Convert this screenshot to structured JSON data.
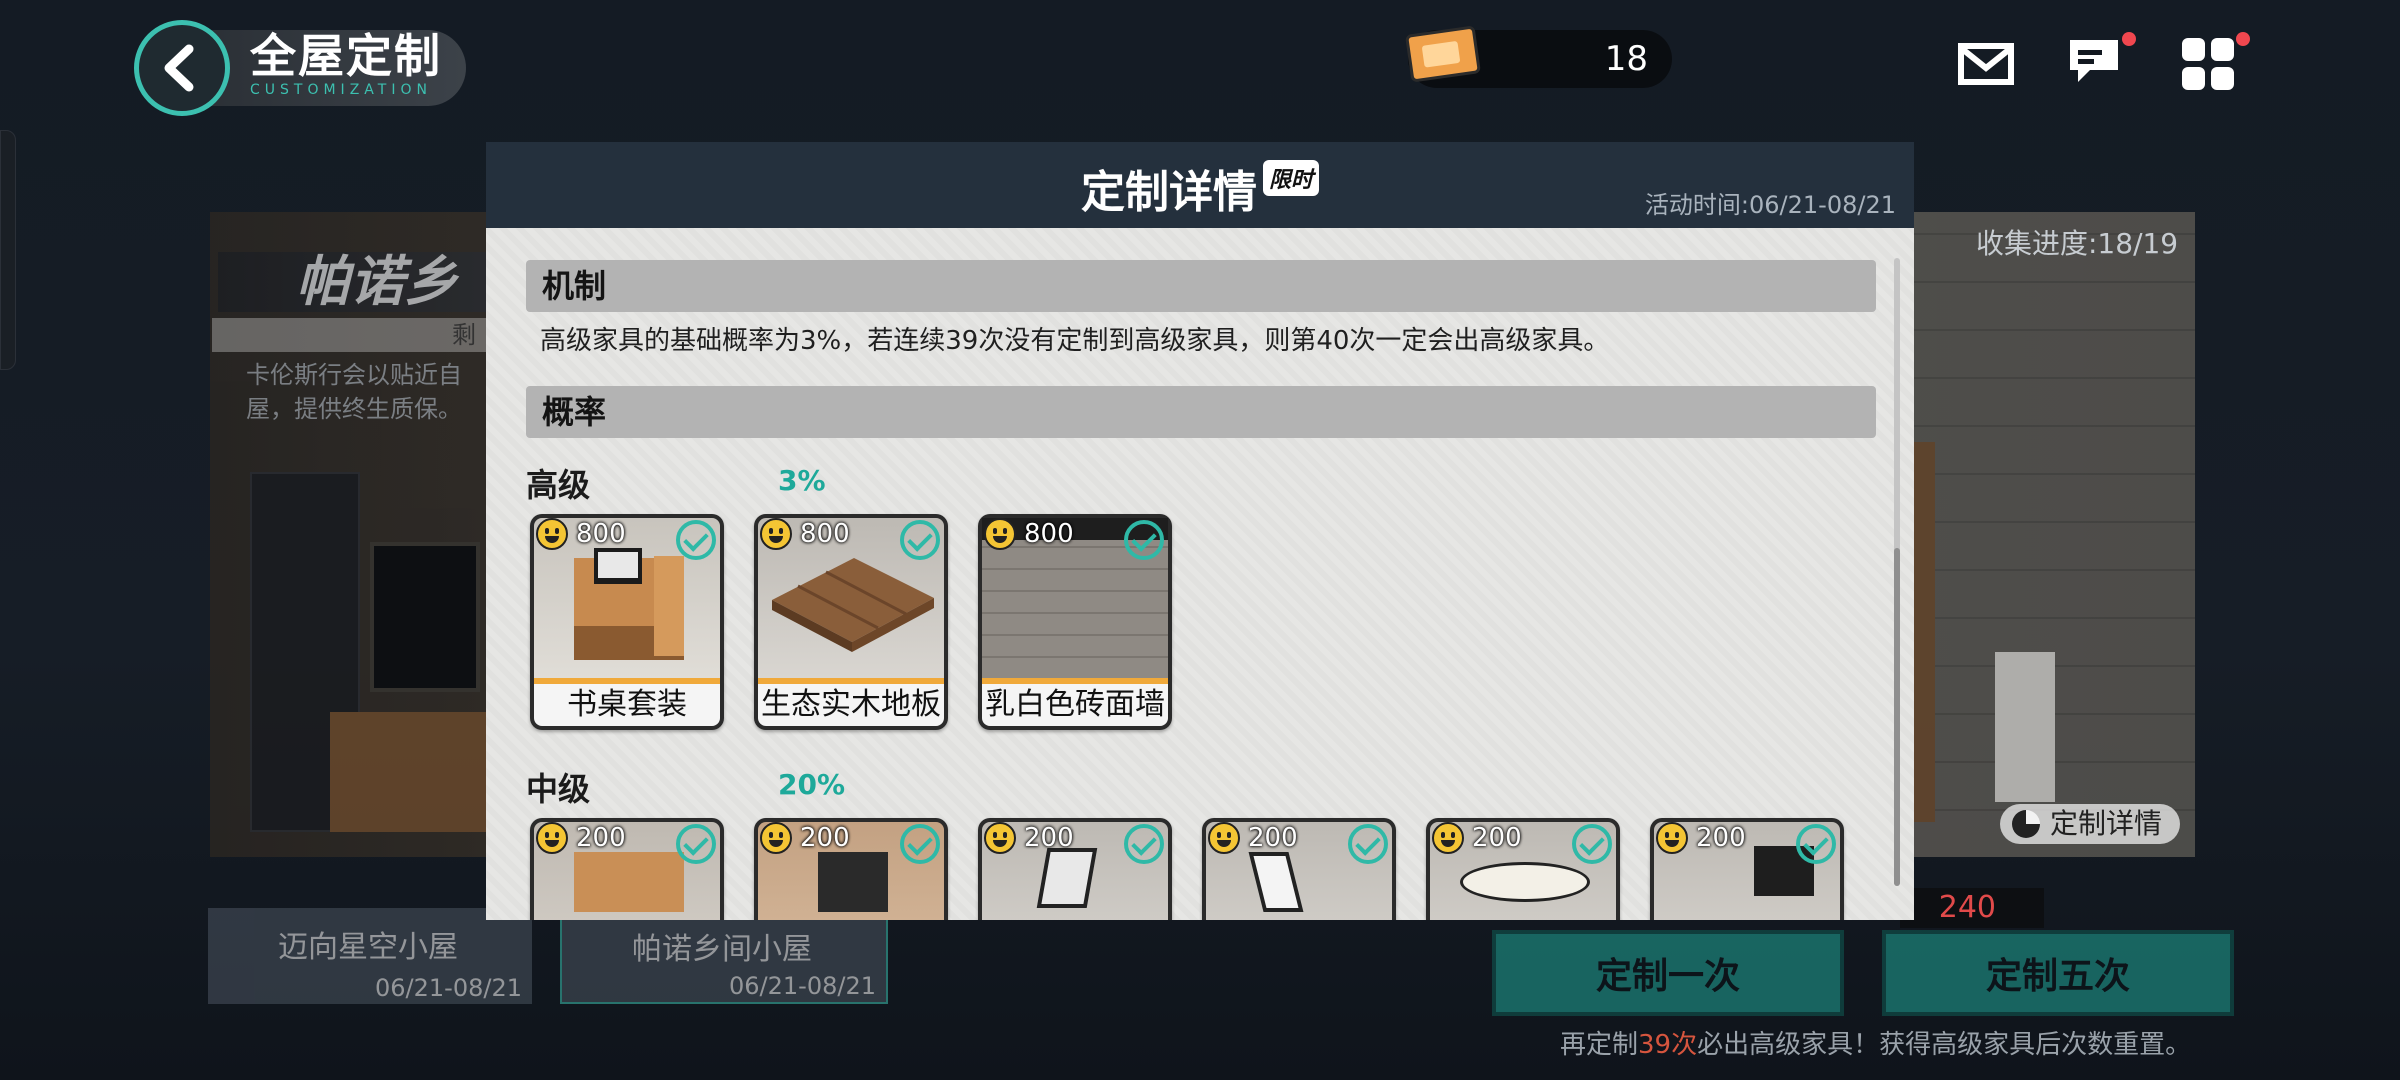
{
  "header": {
    "title": "全屋定制",
    "subtitle": "CUSTOMIZATION",
    "currency_value": "18"
  },
  "background": {
    "room_title": "帕诺乡",
    "room_remaining": "剩",
    "room_desc": "卡伦斯行会以贴近自\n屋，提供终生质保。",
    "collect_progress": "收集进度:18/19",
    "detail_button": "定制详情",
    "cost_value": "240",
    "buttons": {
      "once": "定制一次",
      "five": "定制五次"
    },
    "hint": {
      "pre": "再定制",
      "count": "39次",
      "post": "必出高级家具！获得高级家具后次数重置。"
    },
    "cards": [
      {
        "title": "迈向星空小屋",
        "date": "06/21-08/21"
      },
      {
        "title": "帕诺乡间小屋",
        "date": "06/21-08/21"
      }
    ]
  },
  "modal": {
    "title": "定制详情",
    "limited_tag": "限时",
    "activity_time": "活动时间:06/21-08/21",
    "mechanism_header": "机制",
    "mechanism_text": "高级家具的基础概率为3%，若连续39次没有定制到高级家具，则第40次一定会出高级家具。",
    "probability_header": "概率",
    "tiers": [
      {
        "label": "高级",
        "percent": "3%",
        "items": [
          {
            "cost": "800",
            "name": "书桌套装",
            "owned": true
          },
          {
            "cost": "800",
            "name": "生态实木地板",
            "owned": true
          },
          {
            "cost": "800",
            "name": "乳白色砖面墙",
            "owned": true
          }
        ]
      },
      {
        "label": "中级",
        "percent": "20%",
        "items": [
          {
            "cost": "200",
            "owned": true
          },
          {
            "cost": "200",
            "owned": true
          },
          {
            "cost": "200",
            "owned": true
          },
          {
            "cost": "200",
            "owned": true
          },
          {
            "cost": "200",
            "owned": true
          },
          {
            "cost": "200",
            "owned": true
          }
        ]
      }
    ]
  },
  "colors": {
    "accent": "#1ea99a",
    "modal_header": "#24303d",
    "rarity_stripe": "#f0a93a",
    "alert_dot": "#f0474f"
  },
  "icons": [
    "back-arrow-icon",
    "ticket-icon",
    "mail-icon",
    "chat-icon",
    "grid-menu-icon",
    "smile-icon",
    "check-icon",
    "pie-icon"
  ]
}
